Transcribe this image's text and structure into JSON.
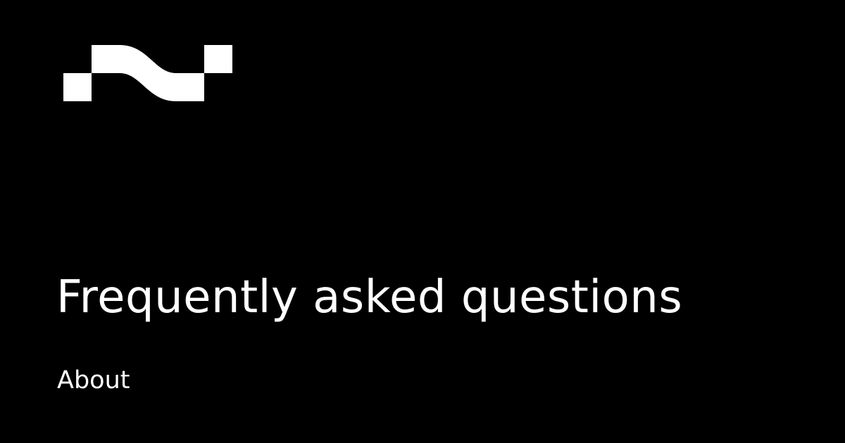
{
  "page": {
    "title": "Frequently asked questions",
    "section": "About"
  },
  "logo": {
    "icon": "wave-logo-icon",
    "color": "#ffffff"
  },
  "theme": {
    "background": "#000000",
    "foreground": "#ffffff"
  }
}
